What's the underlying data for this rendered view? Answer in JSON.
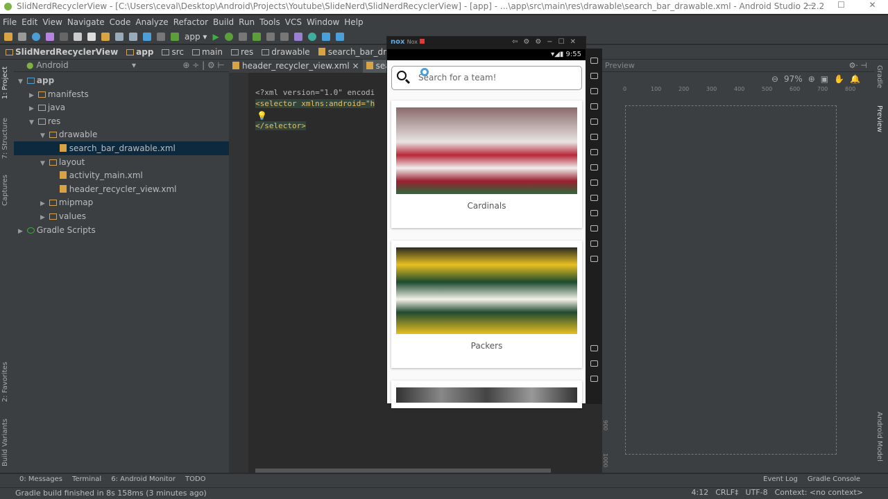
{
  "window": {
    "title": "SlidNerdRecyclerView - [C:\\Users\\ceval\\Desktop\\Android\\Projects\\Youtube\\SlideNerd\\SlidNerdRecyclerView] - [app] - ...\\app\\src\\main\\res\\drawable\\search_bar_drawable.xml - Android Studio 2.2.2",
    "minimize": "—",
    "maximize": "☐",
    "close": "✕"
  },
  "menu": [
    "File",
    "Edit",
    "View",
    "Navigate",
    "Code",
    "Analyze",
    "Refactor",
    "Build",
    "Run",
    "Tools",
    "VCS",
    "Window",
    "Help"
  ],
  "toolbar": {
    "run_config": "app ▾"
  },
  "breadcrumb": [
    "SlidNerdRecyclerView",
    "app",
    "src",
    "main",
    "res",
    "drawable",
    "search_bar_drawable.xml"
  ],
  "left_tabs": {
    "project": "1: Project",
    "structure": "7: Structure",
    "captures": "Captures",
    "favorites": "2: Favorites",
    "build_variants": "Build Variants"
  },
  "project": {
    "view": "Android",
    "tree": [
      {
        "label": "app",
        "level": 0,
        "arrow": "▼"
      },
      {
        "label": "manifests",
        "level": 1,
        "arrow": "▶"
      },
      {
        "label": "java",
        "level": 1,
        "arrow": "▶"
      },
      {
        "label": "res",
        "level": 1,
        "arrow": "▼"
      },
      {
        "label": "drawable",
        "level": 2,
        "arrow": "▼"
      },
      {
        "label": "search_bar_drawable.xml",
        "level": 3,
        "arrow": "",
        "selected": true
      },
      {
        "label": "layout",
        "level": 2,
        "arrow": "▼"
      },
      {
        "label": "activity_main.xml",
        "level": 3,
        "arrow": ""
      },
      {
        "label": "header_recycler_view.xml",
        "level": 3,
        "arrow": ""
      },
      {
        "label": "mipmap",
        "level": 2,
        "arrow": "▶"
      },
      {
        "label": "values",
        "level": 2,
        "arrow": "▶"
      },
      {
        "label": "Gradle Scripts",
        "level": 0,
        "arrow": "▶"
      }
    ]
  },
  "editor": {
    "tabs": [
      "header_recycler_view.xml ×",
      "search_bar_drawable.xml"
    ],
    "lines": [
      "<?xml version=\"1.0\" encodi",
      "<selector xmlns:android=\"h",
      "",
      "</selector>"
    ]
  },
  "emulator": {
    "app_name": "Nox",
    "brand": "nox",
    "time": "9:55",
    "search_placeholder": "Search for a team!",
    "cards": [
      "Cardinals",
      "Packers"
    ]
  },
  "preview": {
    "title": "Preview",
    "zoom": "97%",
    "ruler": [
      "0",
      "100",
      "200",
      "300",
      "400",
      "500",
      "600",
      "700",
      "800"
    ],
    "vruler": [
      "900",
      "1000"
    ]
  },
  "right_tabs": {
    "gradle": "Gradle",
    "preview": "Preview",
    "android_model": "Android Model"
  },
  "bottom_tools": [
    "0: Messages",
    "Terminal",
    "6: Android Monitor",
    "TODO"
  ],
  "bottom_right": [
    "Event Log",
    "Gradle Console"
  ],
  "status": {
    "message": "Gradle build finished in 8s 158ms (3 minutes ago)",
    "position": "4:12",
    "line_sep": "CRLF‡",
    "encoding": "UTF-8",
    "context": "Context: <no context>"
  }
}
